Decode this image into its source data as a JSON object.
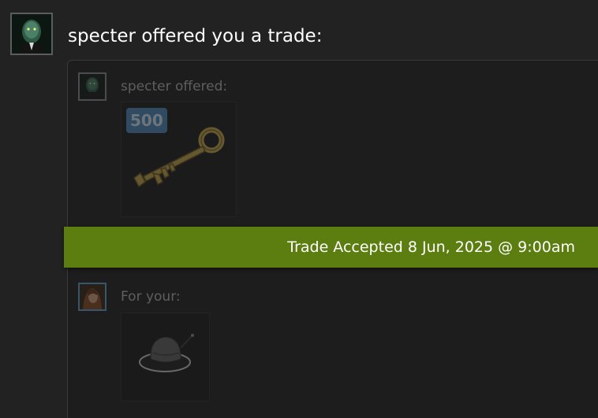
{
  "header": {
    "title": "specter offered you a trade:"
  },
  "offer": {
    "label": "specter offered:",
    "item": {
      "name": "key-icon",
      "quantity": "500"
    }
  },
  "status": {
    "text": "Trade Accepted 8 Jun, 2025 @ 9:00am",
    "color": "#5c7d10"
  },
  "request": {
    "label": "For your:",
    "item": {
      "name": "hat-icon"
    }
  }
}
